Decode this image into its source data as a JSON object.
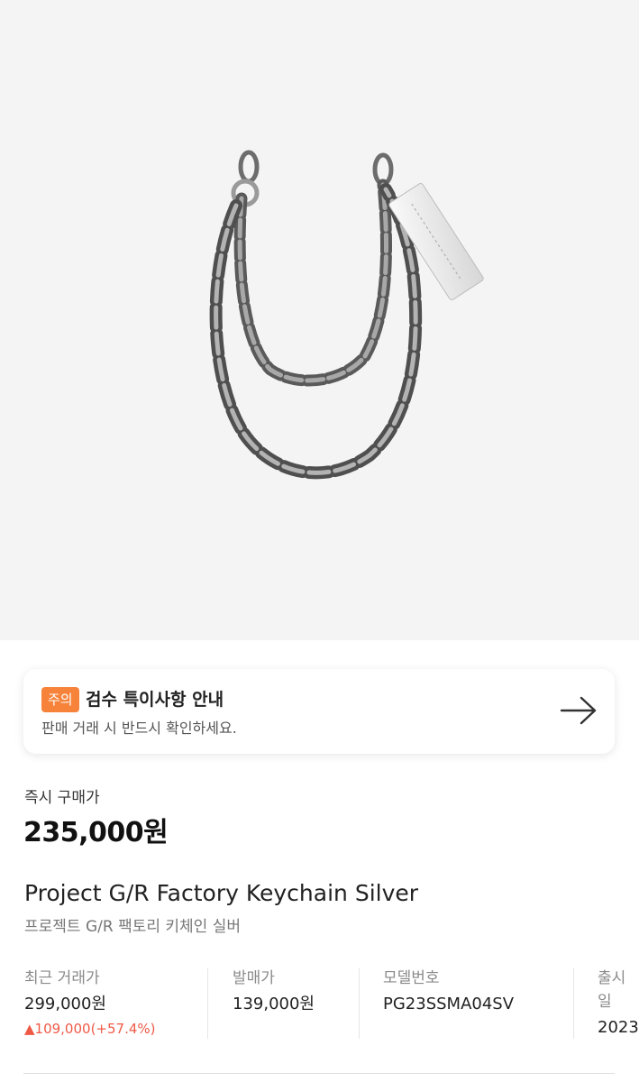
{
  "product_image": {
    "alt_name": "silver-chain-keychain"
  },
  "notice": {
    "badge": "주의",
    "title": "검수 특이사항 안내",
    "subtitle": "판매 거래 시 반드시 확인하세요.",
    "arrow_icon": "arrow-right-icon"
  },
  "price": {
    "label": "즉시 구매가",
    "value": "235,000원"
  },
  "product": {
    "name_en": "Project G/R Factory Keychain Silver",
    "name_ko": "프로젝트 G/R 팩토리 키체인 실버"
  },
  "info": {
    "recent": {
      "label": "최근 거래가",
      "value": "299,000원",
      "change": "▲109,000(+57.4%)"
    },
    "release_price": {
      "label": "발매가",
      "value": "139,000원"
    },
    "model": {
      "label": "모델번호",
      "value": "PG23SSMA04SV"
    },
    "release_date": {
      "label": "출시일",
      "value": "2023"
    }
  },
  "colors": {
    "accent": "#f7823a",
    "increase": "#ef5a47",
    "hero_bg": "#f4f4f4"
  }
}
